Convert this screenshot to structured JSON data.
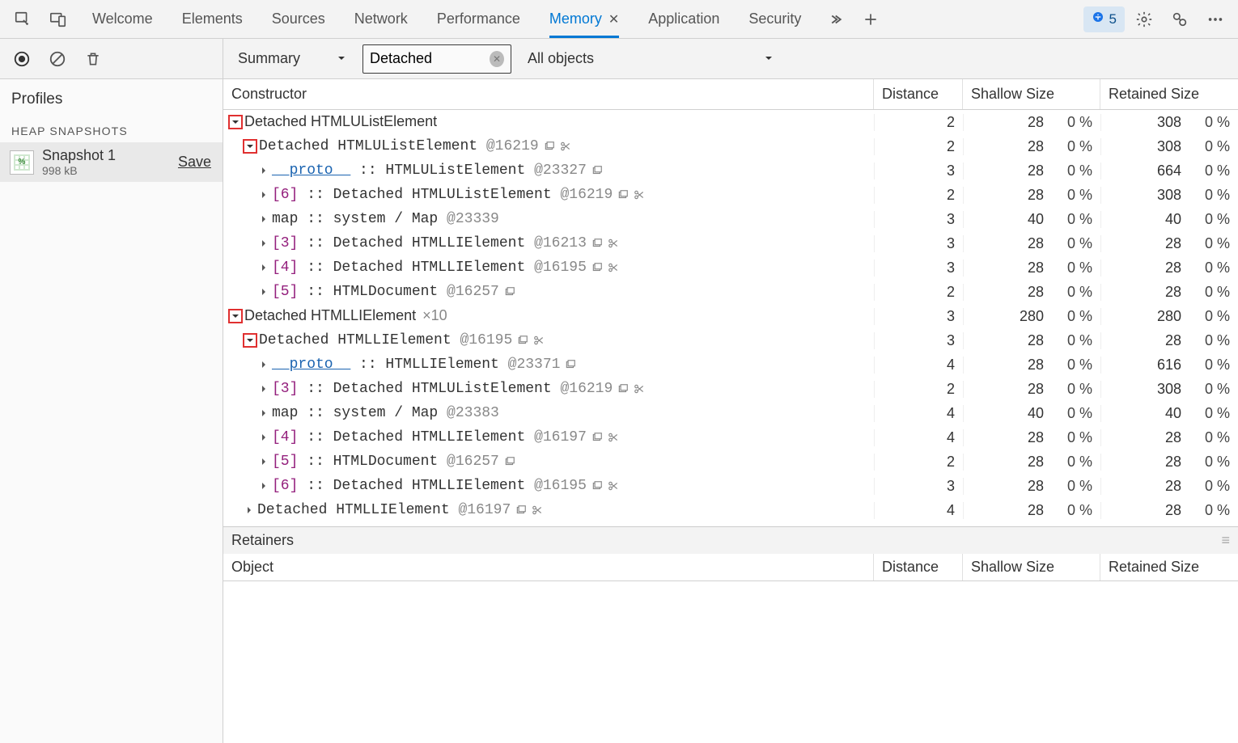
{
  "tabs": {
    "welcome": "Welcome",
    "elements": "Elements",
    "sources": "Sources",
    "network": "Network",
    "performance": "Performance",
    "memory": "Memory",
    "application": "Application",
    "security": "Security"
  },
  "issues_count": "5",
  "toolbar": {
    "perspective": "Summary",
    "filter_value": "Detached",
    "object_filter": "All objects"
  },
  "sidebar": {
    "title": "Profiles",
    "section": "HEAP SNAPSHOTS",
    "snapshot_name": "Snapshot 1",
    "snapshot_size": "998 kB",
    "save": "Save"
  },
  "columns": {
    "constructor": "Constructor",
    "distance": "Distance",
    "shallow": "Shallow Size",
    "retained": "Retained Size",
    "object": "Object"
  },
  "retainers_title": "Retainers",
  "rows": [
    {
      "indent": 0,
      "tw": "down-red",
      "text_plain": "Detached HTMLUListElement",
      "distance": "2",
      "ss": "28",
      "sp": "0 %",
      "rs": "308",
      "rp": "0 %"
    },
    {
      "indent": 1,
      "tw": "down-red",
      "text_html": "Detached HTMLUListElement <span class='objid'>@16219</span>",
      "icons": [
        "window",
        "scissors"
      ],
      "distance": "2",
      "ss": "28",
      "sp": "0 %",
      "rs": "308",
      "rp": "0 %"
    },
    {
      "indent": 2,
      "tw": "right",
      "text_html": "<span class='link'>__proto__</span> :: HTMLUListElement <span class='objid'>@23327</span>",
      "icons": [
        "window"
      ],
      "distance": "3",
      "ss": "28",
      "sp": "0 %",
      "rs": "664",
      "rp": "0 %"
    },
    {
      "indent": 2,
      "tw": "right",
      "text_html": "<span class='keypurple'>[6]</span> :: Detached HTMLUListElement <span class='objid'>@16219</span>",
      "icons": [
        "window",
        "scissors"
      ],
      "distance": "2",
      "ss": "28",
      "sp": "0 %",
      "rs": "308",
      "rp": "0 %"
    },
    {
      "indent": 2,
      "tw": "right",
      "text_html": "map :: system / Map <span class='objid'>@23339</span>",
      "distance": "3",
      "ss": "40",
      "sp": "0 %",
      "rs": "40",
      "rp": "0 %"
    },
    {
      "indent": 2,
      "tw": "right",
      "text_html": "<span class='keypurple'>[3]</span> :: Detached HTMLLIElement <span class='objid'>@16213</span>",
      "icons": [
        "window",
        "scissors"
      ],
      "distance": "3",
      "ss": "28",
      "sp": "0 %",
      "rs": "28",
      "rp": "0 %"
    },
    {
      "indent": 2,
      "tw": "right",
      "text_html": "<span class='keypurple'>[4]</span> :: Detached HTMLLIElement <span class='objid'>@16195</span>",
      "icons": [
        "window",
        "scissors"
      ],
      "distance": "3",
      "ss": "28",
      "sp": "0 %",
      "rs": "28",
      "rp": "0 %"
    },
    {
      "indent": 2,
      "tw": "right",
      "text_html": "<span class='keypurple'>[5]</span> :: HTMLDocument <span class='objid'>@16257</span>",
      "icons": [
        "window"
      ],
      "distance": "2",
      "ss": "28",
      "sp": "0 %",
      "rs": "28",
      "rp": "0 %"
    },
    {
      "indent": 0,
      "tw": "down-red",
      "text_html": "<span style='font-family:Segoe UI,Arial,sans-serif'>Detached HTMLLIElement</span><span class='xcount'>×10</span>",
      "distance": "3",
      "ss": "280",
      "sp": "0 %",
      "rs": "280",
      "rp": "0 %"
    },
    {
      "indent": 1,
      "tw": "down-red",
      "text_html": "Detached HTMLLIElement <span class='objid'>@16195</span>",
      "icons": [
        "window",
        "scissors"
      ],
      "distance": "3",
      "ss": "28",
      "sp": "0 %",
      "rs": "28",
      "rp": "0 %"
    },
    {
      "indent": 2,
      "tw": "right",
      "text_html": "<span class='link'>__proto__</span> :: HTMLLIElement <span class='objid'>@23371</span>",
      "icons": [
        "window"
      ],
      "distance": "4",
      "ss": "28",
      "sp": "0 %",
      "rs": "616",
      "rp": "0 %"
    },
    {
      "indent": 2,
      "tw": "right",
      "text_html": "<span class='keypurple'>[3]</span> :: Detached HTMLUListElement <span class='objid'>@16219</span>",
      "icons": [
        "window",
        "scissors"
      ],
      "distance": "2",
      "ss": "28",
      "sp": "0 %",
      "rs": "308",
      "rp": "0 %"
    },
    {
      "indent": 2,
      "tw": "right",
      "text_html": "map :: system / Map <span class='objid'>@23383</span>",
      "distance": "4",
      "ss": "40",
      "sp": "0 %",
      "rs": "40",
      "rp": "0 %"
    },
    {
      "indent": 2,
      "tw": "right",
      "text_html": "<span class='keypurple'>[4]</span> :: Detached HTMLLIElement <span class='objid'>@16197</span>",
      "icons": [
        "window",
        "scissors"
      ],
      "distance": "4",
      "ss": "28",
      "sp": "0 %",
      "rs": "28",
      "rp": "0 %"
    },
    {
      "indent": 2,
      "tw": "right",
      "text_html": "<span class='keypurple'>[5]</span> :: HTMLDocument <span class='objid'>@16257</span>",
      "icons": [
        "window"
      ],
      "distance": "2",
      "ss": "28",
      "sp": "0 %",
      "rs": "28",
      "rp": "0 %"
    },
    {
      "indent": 2,
      "tw": "right",
      "text_html": "<span class='keypurple'>[6]</span> :: Detached HTMLLIElement <span class='objid'>@16195</span>",
      "icons": [
        "window",
        "scissors"
      ],
      "distance": "3",
      "ss": "28",
      "sp": "0 %",
      "rs": "28",
      "rp": "0 %"
    },
    {
      "indent": 1,
      "tw": "right",
      "text_html": "Detached HTMLLIElement <span class='objid'>@16197</span>",
      "icons": [
        "window",
        "scissors"
      ],
      "distance": "4",
      "ss": "28",
      "sp": "0 %",
      "rs": "28",
      "rp": "0 %"
    }
  ]
}
